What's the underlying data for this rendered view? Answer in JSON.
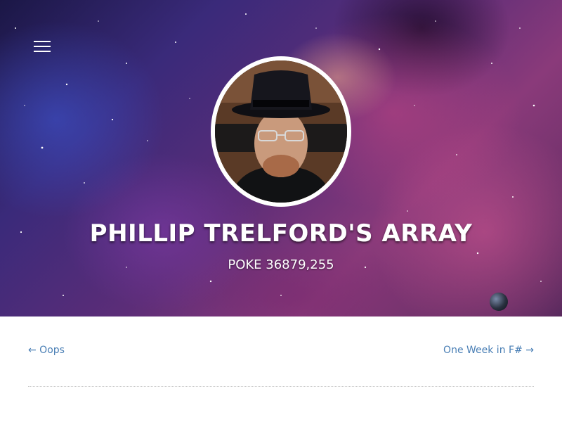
{
  "header": {
    "menu_icon": "hamburger-menu-icon",
    "title": "PHILLIP TRELFORD'S ARRAY",
    "subtitle": "POKE 36879,255",
    "avatar_alt": "Phillip Trelford"
  },
  "post_nav": {
    "prev_label": "← Oops",
    "next_label": "One Week in F# →"
  },
  "colors": {
    "link": "#4a7fb5",
    "title_text": "#ffffff",
    "divider": "#c8c8c8"
  }
}
